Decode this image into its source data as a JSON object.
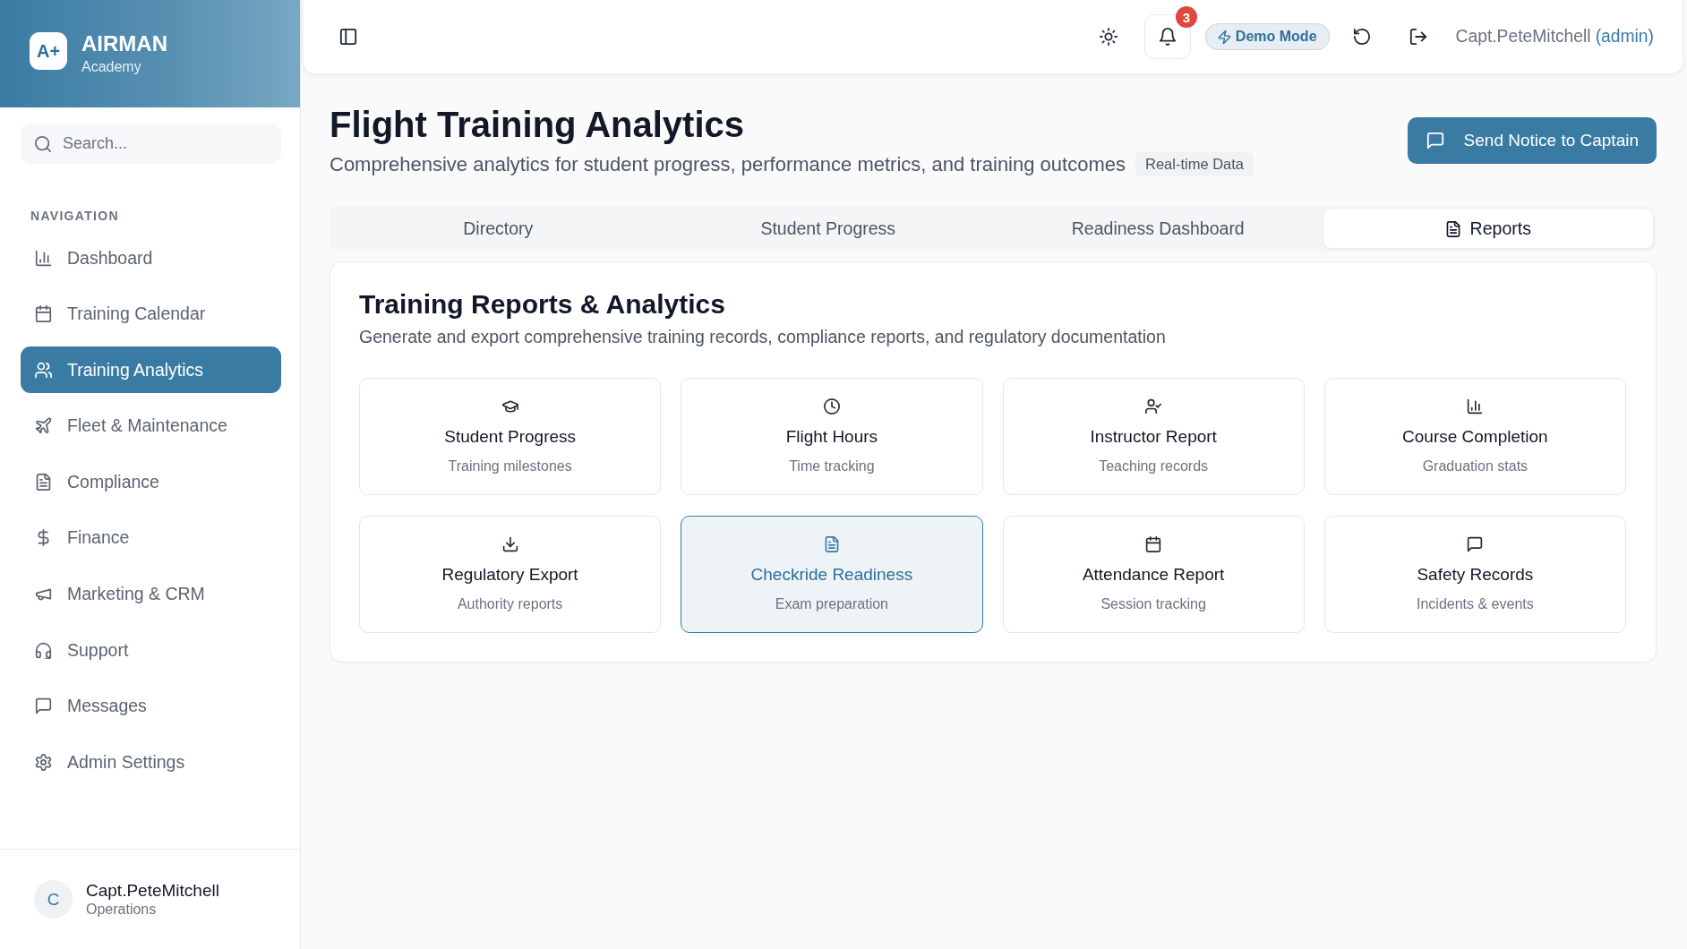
{
  "sidebar": {
    "brand": {
      "logo": "A+",
      "name": "AIRMAN",
      "tagline": "Academy"
    },
    "search": {
      "placeholder": "Search..."
    },
    "section_label": "NAVIGATION",
    "items": [
      {
        "label": "Dashboard",
        "selected": false
      },
      {
        "label": "Training Calendar",
        "selected": false
      },
      {
        "label": "Training Analytics",
        "selected": true
      },
      {
        "label": "Fleet & Maintenance",
        "selected": false
      },
      {
        "label": "Compliance",
        "selected": false
      },
      {
        "label": "Finance",
        "selected": false
      },
      {
        "label": "Marketing & CRM",
        "selected": false
      },
      {
        "label": "Support",
        "selected": false
      },
      {
        "label": "Messages",
        "selected": false
      },
      {
        "label": "Admin Settings",
        "selected": false
      }
    ],
    "user": {
      "initial": "C",
      "name": "Capt.PeteMitchell",
      "role": "Operations"
    }
  },
  "topbar": {
    "notifications": {
      "count": "3"
    },
    "mode_badge": "Demo Mode",
    "user": {
      "name": "Capt.PeteMitchell",
      "role": "(admin)"
    }
  },
  "header": {
    "title": "Flight Training Analytics",
    "subtitle": "Comprehensive analytics for student progress, performance metrics, and training outcomes",
    "badge": "Real-time Data",
    "action": "Send Notice to Captain"
  },
  "tabs": [
    {
      "label": "Directory",
      "selected": false
    },
    {
      "label": "Student Progress",
      "selected": false
    },
    {
      "label": "Readiness Dashboard",
      "selected": false
    },
    {
      "label": "Reports",
      "selected": true
    }
  ],
  "reports": {
    "title": "Training Reports & Analytics",
    "description": "Generate and export comprehensive training records, compliance reports, and regulatory documentation",
    "cards": [
      {
        "title": "Student Progress",
        "subtitle": "Training milestones",
        "selected": false
      },
      {
        "title": "Flight Hours",
        "subtitle": "Time tracking",
        "selected": false
      },
      {
        "title": "Instructor Report",
        "subtitle": "Teaching records",
        "selected": false
      },
      {
        "title": "Course Completion",
        "subtitle": "Graduation stats",
        "selected": false
      },
      {
        "title": "Regulatory Export",
        "subtitle": "Authority reports",
        "selected": false
      },
      {
        "title": "Checkride Readiness",
        "subtitle": "Exam preparation",
        "selected": true
      },
      {
        "title": "Attendance Report",
        "subtitle": "Session tracking",
        "selected": false
      },
      {
        "title": "Safety Records",
        "subtitle": "Incidents & events",
        "selected": false
      }
    ]
  }
}
